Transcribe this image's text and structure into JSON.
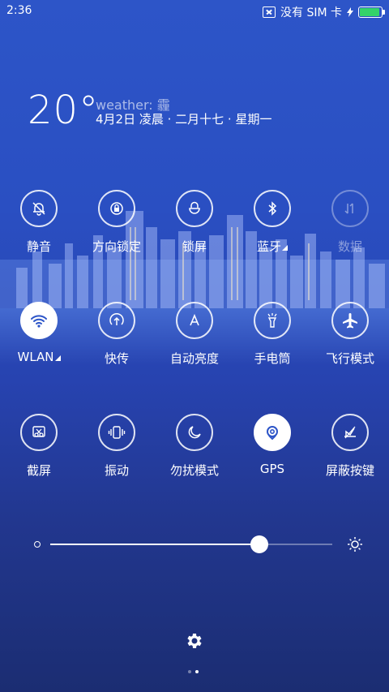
{
  "status_bar": {
    "time": "2:36",
    "carrier": "没有 SIM 卡"
  },
  "weather": {
    "temperature": "20°",
    "condition": "weather: 霾",
    "date": "4月2日 凌晨 · 二月十七 · 星期一"
  },
  "toggles_row1": [
    {
      "label": "静音",
      "icon": "bell-off-icon",
      "state": "off"
    },
    {
      "label": "方向锁定",
      "icon": "rotation-lock-icon",
      "state": "off"
    },
    {
      "label": "锁屏",
      "icon": "lock-icon",
      "state": "off"
    },
    {
      "label": "蓝牙",
      "icon": "bluetooth-icon",
      "state": "off",
      "has_more": true
    },
    {
      "label": "数据",
      "icon": "data-icon",
      "state": "disabled"
    }
  ],
  "toggles_row2": [
    {
      "label": "WLAN",
      "icon": "wifi-icon",
      "state": "on",
      "has_more": true
    },
    {
      "label": "快传",
      "icon": "quick-transfer-icon",
      "state": "off"
    },
    {
      "label": "自动亮度",
      "icon": "auto-brightness-icon",
      "state": "off"
    },
    {
      "label": "手电筒",
      "icon": "flashlight-icon",
      "state": "off"
    },
    {
      "label": "飞行模式",
      "icon": "airplane-icon",
      "state": "off"
    }
  ],
  "toggles_row3": [
    {
      "label": "截屏",
      "icon": "screenshot-icon",
      "state": "off"
    },
    {
      "label": "振动",
      "icon": "vibrate-icon",
      "state": "off"
    },
    {
      "label": "勿扰模式",
      "icon": "moon-icon",
      "state": "off"
    },
    {
      "label": "GPS",
      "icon": "gps-icon",
      "state": "on"
    },
    {
      "label": "屏蔽按键",
      "icon": "block-keys-icon",
      "state": "off"
    }
  ],
  "brightness": {
    "level": 0.74
  },
  "pager": {
    "pages": 2,
    "current": 2
  },
  "colors": {
    "accent": "#2d55c8",
    "battery": "#34d36a"
  }
}
